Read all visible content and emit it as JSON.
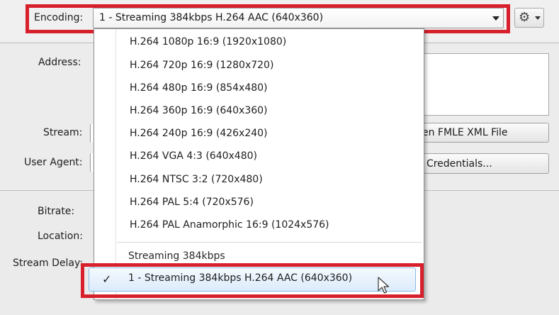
{
  "encoding": {
    "label": "Encoding:",
    "selected": "1 - Streaming 384kbps H.264 AAC (640x360)"
  },
  "gear_menu": {
    "icon": "gear-icon"
  },
  "form": {
    "address_label": "Address:",
    "stream_label": "Stream:",
    "user_agent_label": "User Agent:",
    "open_fmle_button": "en FMLE XML File",
    "credentials_button": "t Credentials...",
    "bitrate_label": "Bitrate:",
    "bitrate_stub": ":",
    "location_label": "Location:",
    "location_stub": "(",
    "stream_delay_label": "Stream Delay:"
  },
  "dropdown": {
    "options": [
      "H.264 1080p 16:9 (1920x1080)",
      "H.264 720p 16:9 (1280x720)",
      "H.264 480p 16:9 (854x480)",
      "H.264 360p 16:9 (640x360)",
      "H.264 240p 16:9 (426x240)",
      "H.264 VGA 4:3 (640x480)",
      "H.264 NTSC 3:2 (720x480)",
      "H.264 PAL 5:4 (720x576)",
      "H.264 PAL Anamorphic 16:9 (1024x576)"
    ],
    "group_header": "Streaming 384kbps",
    "selected_check": "✓",
    "selected_item": "1 - Streaming 384kbps H.264 AAC (640x360)"
  },
  "colors": {
    "highlight_border": "#d7202c",
    "selection_border": "#8bb8e8"
  }
}
